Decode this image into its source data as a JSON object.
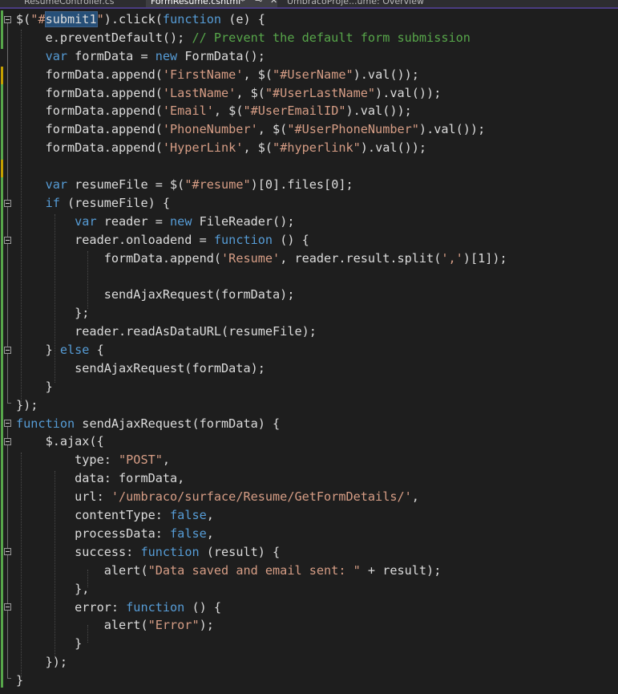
{
  "tabs": [
    {
      "label": "ResumeController.cs",
      "active": false
    },
    {
      "label": "FormResume.cshtml*",
      "active": true
    },
    {
      "label": "UmbracoProje...ume: Overview",
      "active": false
    }
  ],
  "tab_icons": {
    "pin": "⊸",
    "close": "✕"
  },
  "colors": {
    "background": "#1e1e1e",
    "keyword": "#569cd6",
    "string": "#d69d85",
    "comment": "#57a64a",
    "text": "#dcdcdc",
    "change_bar": "#57a64a",
    "selection": "#264f78"
  },
  "code_lines": [
    [
      {
        "t": "$("
      },
      {
        "t": "\"#",
        "c": "str"
      },
      {
        "t": "submit1",
        "c": "hl"
      },
      {
        "t": "\"",
        "c": "str"
      },
      {
        "t": ").click("
      },
      {
        "t": "function",
        "c": "kw"
      },
      {
        "t": " (e) {"
      }
    ],
    [
      {
        "t": "    e.preventDefault(); "
      },
      {
        "t": "// Prevent the default form submission",
        "c": "cmt"
      }
    ],
    [
      {
        "t": "    "
      },
      {
        "t": "var",
        "c": "kw"
      },
      {
        "t": " formData = "
      },
      {
        "t": "new",
        "c": "kw"
      },
      {
        "t": " FormData();"
      }
    ],
    [
      {
        "t": "    formData.append("
      },
      {
        "t": "'FirstName'",
        "c": "str"
      },
      {
        "t": ", $("
      },
      {
        "t": "\"#UserName\"",
        "c": "str"
      },
      {
        "t": ").val());"
      }
    ],
    [
      {
        "t": "    formData.append("
      },
      {
        "t": "'LastName'",
        "c": "str"
      },
      {
        "t": ", $("
      },
      {
        "t": "\"#UserLastName\"",
        "c": "str"
      },
      {
        "t": ").val());"
      }
    ],
    [
      {
        "t": "    formData.append("
      },
      {
        "t": "'Email'",
        "c": "str"
      },
      {
        "t": ", $("
      },
      {
        "t": "\"#UserEmailID\"",
        "c": "str"
      },
      {
        "t": ").val());"
      }
    ],
    [
      {
        "t": "    formData.append("
      },
      {
        "t": "'PhoneNumber'",
        "c": "str"
      },
      {
        "t": ", $("
      },
      {
        "t": "\"#UserPhoneNumber\"",
        "c": "str"
      },
      {
        "t": ").val());"
      }
    ],
    [
      {
        "t": "    formData.append("
      },
      {
        "t": "'HyperLink'",
        "c": "str"
      },
      {
        "t": ", $("
      },
      {
        "t": "\"#hyperlink\"",
        "c": "str"
      },
      {
        "t": ").val());"
      }
    ],
    [
      {
        "t": ""
      }
    ],
    [
      {
        "t": "    "
      },
      {
        "t": "var",
        "c": "kw"
      },
      {
        "t": " resumeFile = $("
      },
      {
        "t": "\"#resume\"",
        "c": "str"
      },
      {
        "t": ")[0].files[0];"
      }
    ],
    [
      {
        "t": "    "
      },
      {
        "t": "if",
        "c": "kw"
      },
      {
        "t": " (resumeFile) {"
      }
    ],
    [
      {
        "t": "        "
      },
      {
        "t": "var",
        "c": "kw"
      },
      {
        "t": " reader = "
      },
      {
        "t": "new",
        "c": "kw"
      },
      {
        "t": " FileReader();"
      }
    ],
    [
      {
        "t": "        reader.onloadend = "
      },
      {
        "t": "function",
        "c": "kw"
      },
      {
        "t": " () {"
      }
    ],
    [
      {
        "t": "            formData.append("
      },
      {
        "t": "'Resume'",
        "c": "str"
      },
      {
        "t": ", reader.result.split("
      },
      {
        "t": "','",
        "c": "str"
      },
      {
        "t": ")[1]);"
      }
    ],
    [
      {
        "t": ""
      }
    ],
    [
      {
        "t": "            sendAjaxRequest(formData);"
      }
    ],
    [
      {
        "t": "        };"
      }
    ],
    [
      {
        "t": "        reader.readAsDataURL(resumeFile);"
      }
    ],
    [
      {
        "t": "    } "
      },
      {
        "t": "else",
        "c": "kw"
      },
      {
        "t": " {"
      }
    ],
    [
      {
        "t": "        sendAjaxRequest(formData);"
      }
    ],
    [
      {
        "t": "    }"
      }
    ],
    [
      {
        "t": "});"
      }
    ],
    [
      {
        "t": "function",
        "c": "kw"
      },
      {
        "t": " sendAjaxRequest(formData) {"
      }
    ],
    [
      {
        "t": "    $.ajax({"
      }
    ],
    [
      {
        "t": "        type: "
      },
      {
        "t": "\"POST\"",
        "c": "str"
      },
      {
        "t": ","
      }
    ],
    [
      {
        "t": "        data: formData,"
      }
    ],
    [
      {
        "t": "        url: "
      },
      {
        "t": "'/umbraco/surface/Resume/GetFormDetails/'",
        "c": "str"
      },
      {
        "t": ","
      }
    ],
    [
      {
        "t": "        contentType: "
      },
      {
        "t": "false",
        "c": "kw"
      },
      {
        "t": ","
      }
    ],
    [
      {
        "t": "        processData: "
      },
      {
        "t": "false",
        "c": "kw"
      },
      {
        "t": ","
      }
    ],
    [
      {
        "t": "        success: "
      },
      {
        "t": "function",
        "c": "kw"
      },
      {
        "t": " (result) {"
      }
    ],
    [
      {
        "t": "            alert("
      },
      {
        "t": "\"Data saved and email sent: \"",
        "c": "str"
      },
      {
        "t": " + result);"
      }
    ],
    [
      {
        "t": "        },"
      }
    ],
    [
      {
        "t": "        error: "
      },
      {
        "t": "function",
        "c": "kw"
      },
      {
        "t": " () {"
      }
    ],
    [
      {
        "t": "            alert("
      },
      {
        "t": "\"Error\"",
        "c": "str"
      },
      {
        "t": ");"
      }
    ],
    [
      {
        "t": "        }"
      }
    ],
    [
      {
        "t": "    });"
      }
    ],
    [
      {
        "t": "}"
      }
    ]
  ]
}
